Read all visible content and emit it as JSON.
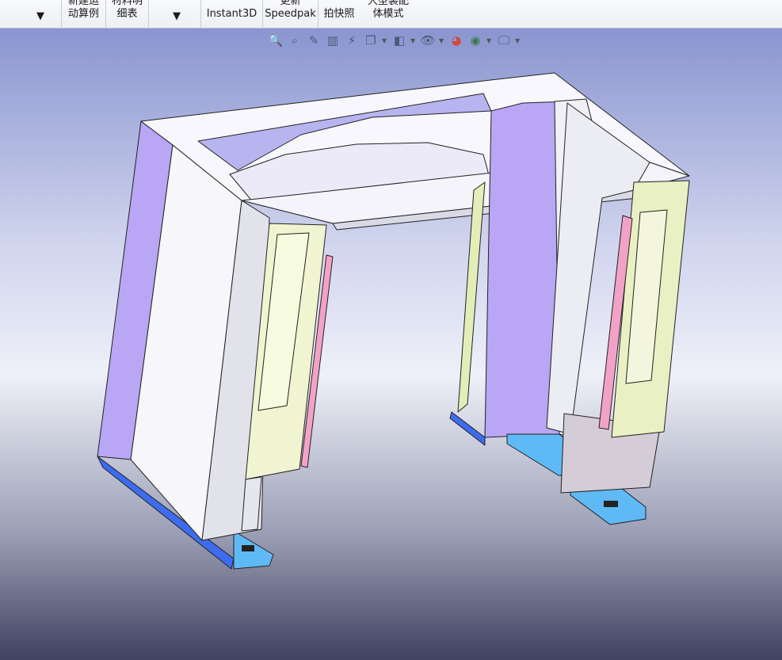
{
  "ribbon": {
    "buttons": [
      {
        "line1": "",
        "line2": ""
      },
      {
        "line1": "新建运",
        "line2": "动算例"
      },
      {
        "line1": "材料明",
        "line2": "细表"
      },
      {
        "line1": "",
        "line2": ""
      },
      {
        "line1": "Instant3D",
        "line2": ""
      },
      {
        "line1": "更新",
        "line2": "Speedpak"
      },
      {
        "line1": "拍快照",
        "line2": ""
      },
      {
        "line1": "大型装配",
        "line2": "体模式"
      }
    ]
  },
  "heads_up_toolbar": {
    "icons": [
      "zoom-to-fit-icon",
      "zoom-area-icon",
      "previous-view-icon",
      "section-view-icon",
      "dynamic-annotation-icon",
      "view-orientation-icon",
      "display-style-icon",
      "hide-show-icon",
      "edit-appearance-icon",
      "apply-scene-icon",
      "view-settings-icon"
    ]
  },
  "colors": {
    "panel_purple": "#b9a6f4",
    "panel_white": "#f6f6fb",
    "door_green": "#eef3c9",
    "base_blue": "#3d6cf0",
    "light_blue": "#5fb9f5",
    "pink_strip": "#f2a2c6"
  }
}
